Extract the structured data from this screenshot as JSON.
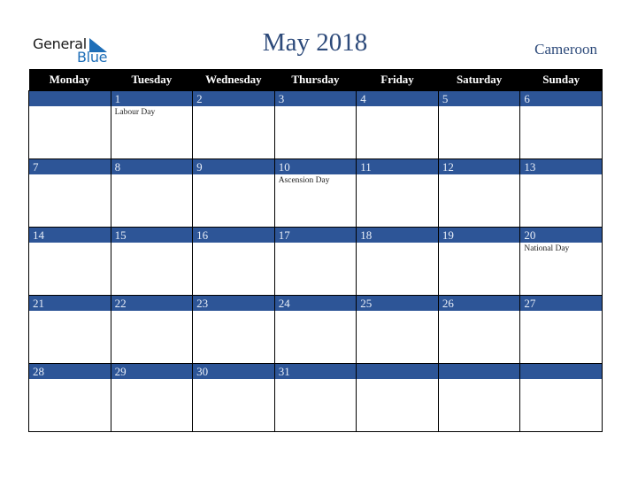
{
  "logo": {
    "line1": "General",
    "line2": "Blue",
    "icon": "triangle-logo-icon"
  },
  "header": {
    "title": "May 2018",
    "country": "Cameroon"
  },
  "colors": {
    "accent": "#2d5597",
    "header_bg": "#000000",
    "title_color": "#2d4a7a",
    "logo_blue": "#1f6fb8"
  },
  "weekdays": [
    "Monday",
    "Tuesday",
    "Wednesday",
    "Thursday",
    "Friday",
    "Saturday",
    "Sunday"
  ],
  "weeks": [
    [
      {
        "day": "",
        "holiday": ""
      },
      {
        "day": "1",
        "holiday": "Labour Day"
      },
      {
        "day": "2",
        "holiday": ""
      },
      {
        "day": "3",
        "holiday": ""
      },
      {
        "day": "4",
        "holiday": ""
      },
      {
        "day": "5",
        "holiday": ""
      },
      {
        "day": "6",
        "holiday": ""
      }
    ],
    [
      {
        "day": "7",
        "holiday": ""
      },
      {
        "day": "8",
        "holiday": ""
      },
      {
        "day": "9",
        "holiday": ""
      },
      {
        "day": "10",
        "holiday": "Ascension Day"
      },
      {
        "day": "11",
        "holiday": ""
      },
      {
        "day": "12",
        "holiday": ""
      },
      {
        "day": "13",
        "holiday": ""
      }
    ],
    [
      {
        "day": "14",
        "holiday": ""
      },
      {
        "day": "15",
        "holiday": ""
      },
      {
        "day": "16",
        "holiday": ""
      },
      {
        "day": "17",
        "holiday": ""
      },
      {
        "day": "18",
        "holiday": ""
      },
      {
        "day": "19",
        "holiday": ""
      },
      {
        "day": "20",
        "holiday": "National Day"
      }
    ],
    [
      {
        "day": "21",
        "holiday": ""
      },
      {
        "day": "22",
        "holiday": ""
      },
      {
        "day": "23",
        "holiday": ""
      },
      {
        "day": "24",
        "holiday": ""
      },
      {
        "day": "25",
        "holiday": ""
      },
      {
        "day": "26",
        "holiday": ""
      },
      {
        "day": "27",
        "holiday": ""
      }
    ],
    [
      {
        "day": "28",
        "holiday": ""
      },
      {
        "day": "29",
        "holiday": ""
      },
      {
        "day": "30",
        "holiday": ""
      },
      {
        "day": "31",
        "holiday": ""
      },
      {
        "day": "",
        "holiday": ""
      },
      {
        "day": "",
        "holiday": ""
      },
      {
        "day": "",
        "holiday": ""
      }
    ]
  ]
}
